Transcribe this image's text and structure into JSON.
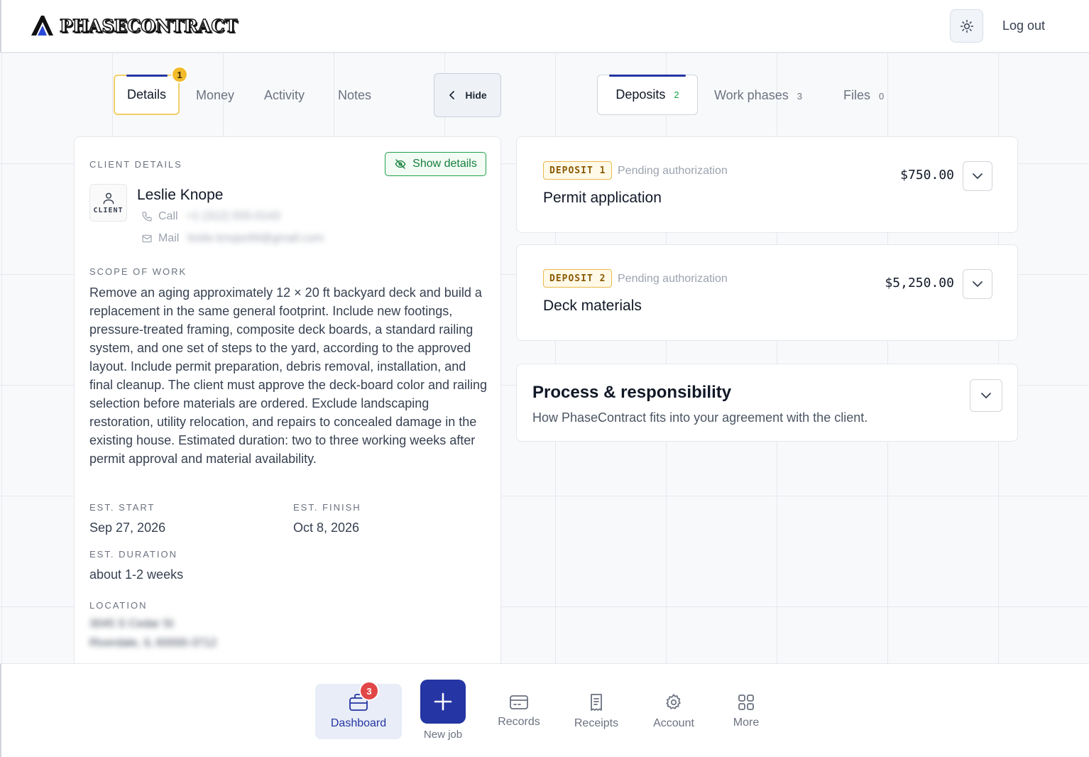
{
  "header": {
    "brand": "PHASECONTRACT",
    "logout_label": "Log out"
  },
  "left_tabs": {
    "active": "Details",
    "active_badge": "1",
    "items": [
      "Money",
      "Activity",
      "Notes"
    ],
    "hide_label": "Hide"
  },
  "right_tabs": [
    {
      "label": "Deposits",
      "count": "2"
    },
    {
      "label": "Work phases",
      "count": "3"
    },
    {
      "label": "Files",
      "count": "0"
    }
  ],
  "client": {
    "section_label": "CLIENT DETAILS",
    "show_details_label": "Show details",
    "avatar_tag": "CLIENT",
    "name": "Leslie Knope",
    "call_label": "Call",
    "call_value": "+1 (312) 555-0143",
    "mail_label": "Mail",
    "mail_value": "leslie.knope99@gmail.com"
  },
  "scope": {
    "label": "SCOPE OF WORK",
    "text": "Remove an aging approximately 12 × 20 ft backyard deck and build a replacement in the same general footprint. Include new footings, pressure-treated framing, composite deck boards, a standard railing system, and one set of steps to the yard, according to the approved layout. Include permit preparation, debris removal, installation, and final cleanup. The client must approve the deck-board color and railing selection before materials are ordered. Exclude landscaping restoration, utility relocation, and repairs to concealed damage in the existing house. Estimated duration: two to three working weeks after permit approval and material availability."
  },
  "schedule": {
    "start_label": "EST. START",
    "start_value": "Sep 27, 2026",
    "finish_label": "EST. FINISH",
    "finish_value": "Oct 8, 2026",
    "duration_label": "EST. DURATION",
    "duration_value": "about 1-2 weeks"
  },
  "location": {
    "label": "LOCATION",
    "line1": "3045 S Cedar St",
    "line2": "Riverdale, IL 60000-3712"
  },
  "deposits": [
    {
      "tag": "DEPOSIT 1",
      "status": "Pending authorization",
      "title": "Permit application",
      "amount": "$750.00"
    },
    {
      "tag": "DEPOSIT 2",
      "status": "Pending authorization",
      "title": "Deck materials",
      "amount": "$5,250.00"
    }
  ],
  "process": {
    "title": "Process & responsibility",
    "subtitle": "How PhaseContract fits into your agreement with the client."
  },
  "bottom_nav": {
    "dashboard_label": "Dashboard",
    "dashboard_badge": "3",
    "new_job_label": "New job",
    "records_label": "Records",
    "receipts_label": "Receipts",
    "account_label": "Account",
    "more_label": "More"
  },
  "colors": {
    "primary": "#2535a3",
    "accent_yellow": "#f2bb2c",
    "success_green": "#16803c",
    "badge_red": "#e14747"
  }
}
